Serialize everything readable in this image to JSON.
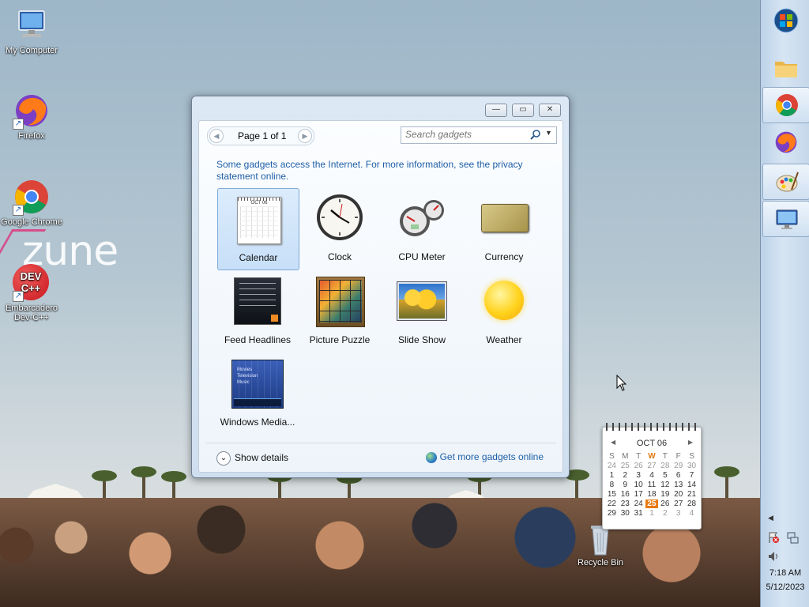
{
  "desktop": {
    "icons": [
      {
        "label": "My Computer"
      },
      {
        "label": "Firefox"
      },
      {
        "label": "Google Chrome"
      },
      {
        "label": "Embarcadero Dev-C++"
      },
      {
        "label": "Recycle Bin"
      }
    ],
    "wallpaper_text": "zune",
    "devcpp_glyph": "DEV C++"
  },
  "gallery": {
    "window_buttons": {
      "minimize": "—",
      "restore": "▭",
      "close": "✕"
    },
    "pager": {
      "text": "Page 1 of 1",
      "prev": "◀",
      "next": "▶"
    },
    "search": {
      "placeholder": "Search gadgets"
    },
    "notice": "Some gadgets access the Internet.  For more information, see the privacy statement online.",
    "gadgets": [
      {
        "label": "Calendar",
        "selected": true
      },
      {
        "label": "Clock"
      },
      {
        "label": "CPU Meter"
      },
      {
        "label": "Currency"
      },
      {
        "label": "Feed Headlines"
      },
      {
        "label": "Picture Puzzle"
      },
      {
        "label": "Slide Show"
      },
      {
        "label": "Weather"
      },
      {
        "label": "Windows Media..."
      }
    ],
    "calendar_thumb_month": "OCT 06",
    "media_thumb_lines": [
      "Movies",
      "Television",
      "Music"
    ],
    "show_details": "Show details",
    "get_more": "Get more gadgets online"
  },
  "calendar_gadget": {
    "month": "OCT 06",
    "weekdays": [
      "S",
      "M",
      "T",
      "W",
      "T",
      "F",
      "S"
    ],
    "today_weekday_index": 3,
    "today": "25",
    "weeks": [
      [
        "24",
        "25",
        "26",
        "27",
        "28",
        "29",
        "30"
      ],
      [
        "1",
        "2",
        "3",
        "4",
        "5",
        "6",
        "7"
      ],
      [
        "8",
        "9",
        "10",
        "11",
        "12",
        "13",
        "14"
      ],
      [
        "15",
        "16",
        "17",
        "18",
        "19",
        "20",
        "21"
      ],
      [
        "22",
        "23",
        "24",
        "25",
        "26",
        "27",
        "28"
      ],
      [
        "29",
        "30",
        "31",
        "1",
        "2",
        "3",
        "4"
      ]
    ]
  },
  "taskbar": {
    "time": "7:18 AM",
    "date": "5/12/2023",
    "items": [
      "start",
      "explorer",
      "chrome",
      "firefox",
      "paint",
      "remote-desktop"
    ]
  },
  "colors": {
    "accent_link": "#1f5fa6",
    "today_highlight": "#e87a10"
  }
}
